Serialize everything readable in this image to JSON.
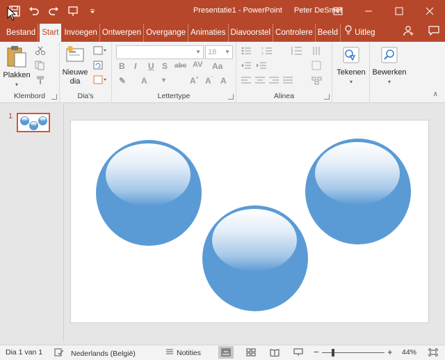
{
  "window": {
    "doc_title": "Presentatie1 - PowerPoint",
    "user_name": "Peter DeSmet"
  },
  "tabs": [
    {
      "label": "Bestand",
      "active": false
    },
    {
      "label": "Start",
      "active": true
    },
    {
      "label": "Invoegen",
      "active": false
    },
    {
      "label": "Ontwerpen",
      "active": false
    },
    {
      "label": "Overgange",
      "active": false
    },
    {
      "label": "Animaties",
      "active": false
    },
    {
      "label": "Diavoorstel",
      "active": false
    },
    {
      "label": "Controlere",
      "active": false
    },
    {
      "label": "Beeld",
      "active": false
    }
  ],
  "tell_me": "Uitleg",
  "ribbon": {
    "clipboard": {
      "paste_label": "Plakken",
      "group_label": "Klembord"
    },
    "slides": {
      "new_slide_line1": "Nieuwe",
      "new_slide_line2": "dia",
      "group_label": "Dia's"
    },
    "font": {
      "font_size": "18",
      "group_label": "Lettertype"
    },
    "paragraph": {
      "group_label": "Alinea"
    },
    "drawing": {
      "label": "Tekenen"
    },
    "editing": {
      "label": "Bewerken"
    }
  },
  "thumbnails": [
    {
      "number": "1"
    }
  ],
  "statusbar": {
    "slide_info": "Dia 1 van 1",
    "language": "Nederlands (België)",
    "notes_label": "Notities",
    "zoom_level": "44%"
  },
  "colors": {
    "accent": "#b7472a",
    "sphere": "#5b9bd5"
  },
  "icons": [
    "save-icon",
    "undo-icon",
    "redo-icon",
    "present-icon",
    "customize-qat-icon",
    "ribbon-display-icon",
    "minimize-icon",
    "maximize-icon",
    "close-icon",
    "lightbulb-icon",
    "share-icon",
    "comments-icon"
  ]
}
